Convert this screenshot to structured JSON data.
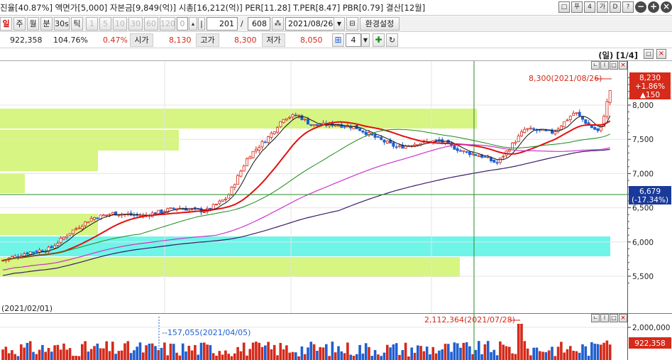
{
  "header": {
    "info": "진율[40.87%] 액면가[5,000] 자본금[9,849(억)] 시총[16,212(억)] PER[11.28] T.PER[8.47] PBR[0.79] 결산[12월]",
    "window_buttons": [
      "□",
      "푸",
      "4",
      "가",
      "D",
      "?"
    ]
  },
  "toolbar": {
    "periods": [
      "일",
      "주",
      "월",
      "분",
      "30s",
      "틱"
    ],
    "active_period": "일",
    "intervals": [
      "1",
      "5",
      "10",
      "30",
      "60",
      "120"
    ],
    "custom_value": "0",
    "count_value": "201",
    "separator": "/",
    "total_value": "608",
    "date_value": "2021/08/26",
    "settings_label": "환경설정"
  },
  "quote": {
    "volume": "922,358",
    "volume_ratio": "104.76%",
    "change_pct": "0.47%",
    "open_label": "시가",
    "open": "8,130",
    "high_label": "고가",
    "high": "8,300",
    "low_label": "저가",
    "low": "8,050",
    "grid_value": "4"
  },
  "chart_header": {
    "label": "(일) [1/4]"
  },
  "price_axis": {
    "ticks": [
      "8,000",
      "7,500",
      "7,000",
      "6,500",
      "6,000",
      "5,500"
    ],
    "current_price": "8,230",
    "current_change": "+1.86%",
    "current_delta": "▲150",
    "crosshair_price": "6,679",
    "crosshair_pct": "(-17.34%)"
  },
  "annotations": {
    "high_label": "8,300(2021/08/26)",
    "start_date": "(2021/02/01)",
    "vol_low_label": "--157,055(2021/04/05)",
    "vol_high_label": "2,112,364(2021/07/28)"
  },
  "volume_axis": {
    "tick": "2,000,000",
    "current_volume": "922,358"
  },
  "colors": {
    "up": "#d42a1a",
    "down": "#1f5fd0",
    "ma5": "#111111",
    "ma20": "#e01010",
    "ma60": "#1a8a1a",
    "ma120": "#cc33cc",
    "ma240": "#3a1a6a",
    "zone_green": "#d6f582",
    "zone_cyan": "#6ff5e8",
    "price_badge": "#d62a1a",
    "crosshair_badge": "#1a3a9a"
  }
}
